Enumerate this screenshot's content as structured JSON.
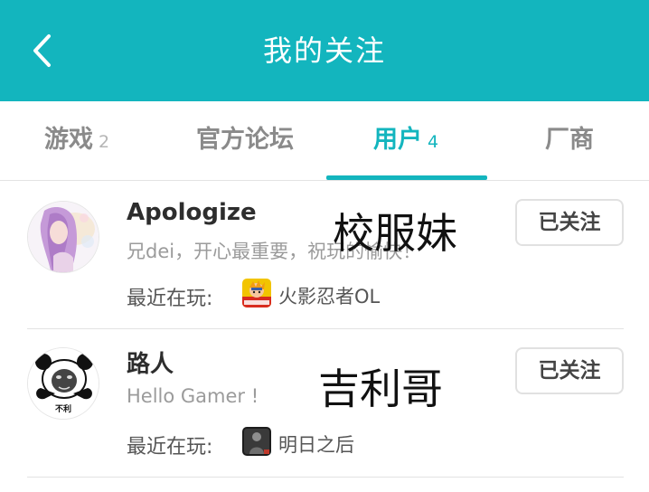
{
  "header": {
    "title": "我的关注",
    "back_icon": "chevron-left-icon",
    "background_color": "#13b5be"
  },
  "tabs": [
    {
      "label": "游戏",
      "count": "2",
      "active": false
    },
    {
      "label": "官方论坛",
      "count": "",
      "active": false
    },
    {
      "label": "用户",
      "count": "4",
      "active": true
    },
    {
      "label": "厂商",
      "count": "",
      "active": false
    }
  ],
  "accent_color": "#13b5be",
  "users": [
    {
      "name": "Apologize",
      "overlay_text": "校服妹",
      "signature": "兄dei，开心最重要，祝玩的愉快！",
      "recent_label": "最近在玩:",
      "recent_game": "火影忍者OL",
      "follow_label": "已关注"
    },
    {
      "name": "路人",
      "overlay_text": "吉利哥",
      "signature": "Hello Gamer !",
      "recent_label": "最近在玩:",
      "recent_game": "明日之后",
      "follow_label": "已关注"
    }
  ],
  "avatar_caption": "不利"
}
